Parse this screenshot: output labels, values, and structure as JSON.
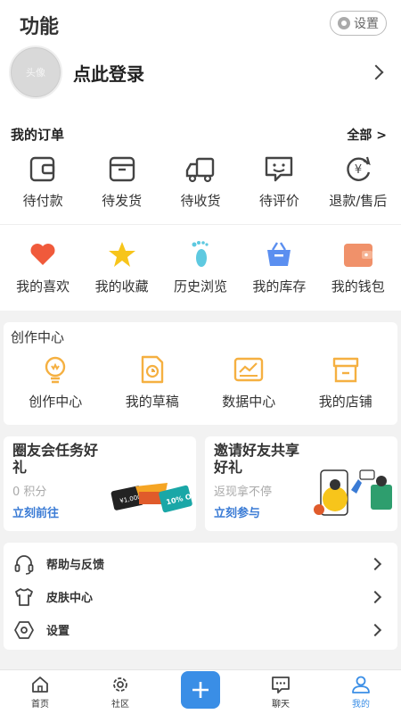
{
  "header": {
    "title": "功能",
    "settings_label": "设置"
  },
  "profile": {
    "login_text": "点此登录",
    "avatar_text": "头像"
  },
  "orders": {
    "title": "我的订单",
    "all_label": "全部 >",
    "items": [
      {
        "label": "待付款",
        "icon": "wallet-icon"
      },
      {
        "label": "待发货",
        "icon": "box-icon"
      },
      {
        "label": "待收货",
        "icon": "truck-icon"
      },
      {
        "label": "待评价",
        "icon": "comment-icon"
      },
      {
        "label": "退款/售后",
        "icon": "refund-icon"
      }
    ]
  },
  "favorites": {
    "items": [
      {
        "label": "我的喜欢",
        "icon": "heart-icon",
        "color": "#f05a3b"
      },
      {
        "label": "我的收藏",
        "icon": "star-icon",
        "color": "#f7c51b"
      },
      {
        "label": "历史浏览",
        "icon": "footprint-icon",
        "color": "#5ec9e0"
      },
      {
        "label": "我的库存",
        "icon": "basket-icon",
        "color": "#5b8ff0"
      },
      {
        "label": "我的钱包",
        "icon": "wallet-fill-icon",
        "color": "#f0916a"
      }
    ]
  },
  "creation": {
    "title": "创作中心",
    "accent": "#f5b041",
    "items": [
      {
        "label": "创作中心",
        "icon": "bulb-icon"
      },
      {
        "label": "我的草稿",
        "icon": "draft-icon"
      },
      {
        "label": "数据中心",
        "icon": "chart-icon"
      },
      {
        "label": "我的店铺",
        "icon": "shop-icon"
      }
    ]
  },
  "tasks": {
    "left": {
      "title": "圈友会任务好礼",
      "sub": "0 积分",
      "link": "立刻前往"
    },
    "right": {
      "title": "邀请好友共享好礼",
      "sub": "返现拿不停",
      "link": "立刻参与"
    }
  },
  "menu": [
    {
      "label": "帮助与反馈",
      "icon": "headset-icon"
    },
    {
      "label": "皮肤中心",
      "icon": "tshirt-icon"
    },
    {
      "label": "设置",
      "icon": "hexagon-settings-icon"
    }
  ],
  "tabbar": {
    "active_color": "#3a8ee6",
    "items": [
      {
        "label": "首页",
        "icon": "home-icon"
      },
      {
        "label": "社区",
        "icon": "gear-community-icon"
      },
      {
        "label": "",
        "icon": "plus-icon"
      },
      {
        "label": "聊天",
        "icon": "chat-icon"
      },
      {
        "label": "我的",
        "icon": "user-icon"
      }
    ]
  }
}
